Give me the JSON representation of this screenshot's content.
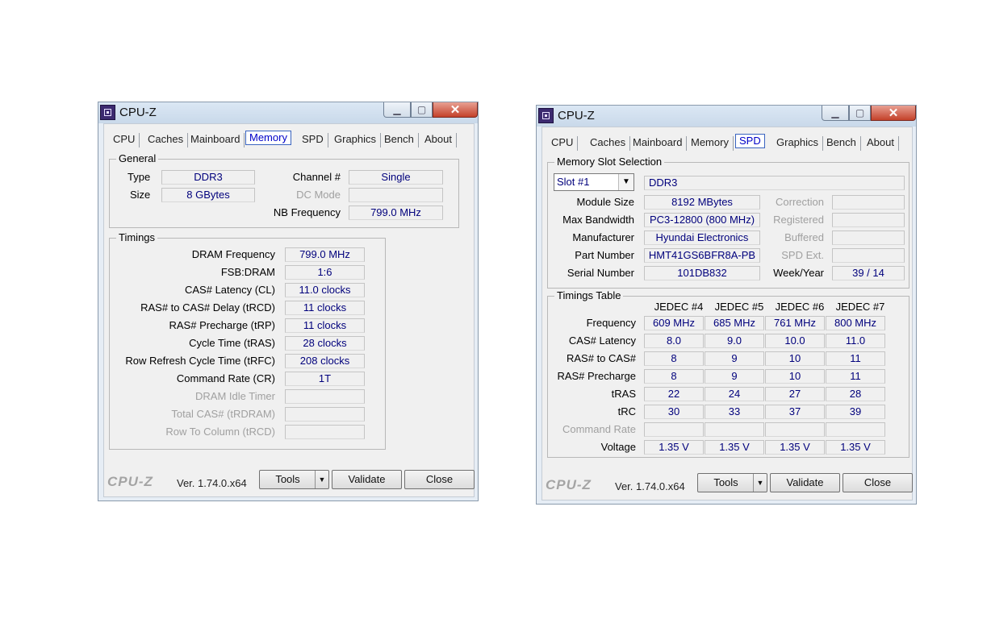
{
  "left_window": {
    "title": "CPU-Z",
    "tabs": [
      "CPU",
      "Caches",
      "Mainboard",
      "Memory",
      "SPD",
      "Graphics",
      "Bench",
      "About"
    ],
    "active_tab": "Memory",
    "general": {
      "label": "General",
      "type_label": "Type",
      "type_value": "DDR3",
      "size_label": "Size",
      "size_value": "8 GBytes",
      "channel_label": "Channel #",
      "channel_value": "Single",
      "dcmode_label": "DC Mode",
      "dcmode_value": "",
      "nbfreq_label": "NB Frequency",
      "nbfreq_value": "799.0 MHz"
    },
    "timings": {
      "label": "Timings",
      "rows": [
        {
          "label": "DRAM Frequency",
          "value": "799.0 MHz"
        },
        {
          "label": "FSB:DRAM",
          "value": "1:6"
        },
        {
          "label": "CAS# Latency (CL)",
          "value": "11.0 clocks"
        },
        {
          "label": "RAS# to CAS# Delay (tRCD)",
          "value": "11 clocks"
        },
        {
          "label": "RAS# Precharge (tRP)",
          "value": "11 clocks"
        },
        {
          "label": "Cycle Time (tRAS)",
          "value": "28 clocks"
        },
        {
          "label": "Row Refresh Cycle Time (tRFC)",
          "value": "208 clocks"
        },
        {
          "label": "Command Rate (CR)",
          "value": "1T"
        },
        {
          "label": "DRAM Idle Timer",
          "value": ""
        },
        {
          "label": "Total CAS# (tRDRAM)",
          "value": ""
        },
        {
          "label": "Row To Column (tRCD)",
          "value": ""
        }
      ]
    },
    "footer": {
      "logo": "CPU-Z",
      "version": "Ver. 1.74.0.x64",
      "tools": "Tools",
      "validate": "Validate",
      "close": "Close"
    }
  },
  "right_window": {
    "title": "CPU-Z",
    "tabs": [
      "CPU",
      "Caches",
      "Mainboard",
      "Memory",
      "SPD",
      "Graphics",
      "Bench",
      "About"
    ],
    "active_tab": "SPD",
    "slot_group": {
      "label": "Memory Slot Selection",
      "slot_select": "Slot #1",
      "slot_type": "DDR3",
      "module_size_label": "Module Size",
      "module_size": "8192 MBytes",
      "max_bw_label": "Max Bandwidth",
      "max_bw": "PC3-12800 (800 MHz)",
      "manufacturer_label": "Manufacturer",
      "manufacturer": "Hyundai Electronics",
      "part_label": "Part Number",
      "part": "HMT41GS6BFR8A-PB",
      "serial_label": "Serial Number",
      "serial": "101DB832",
      "correction_label": "Correction",
      "correction": "",
      "registered_label": "Registered",
      "registered": "",
      "buffered_label": "Buffered",
      "buffered": "",
      "spdext_label": "SPD Ext.",
      "spdext": "",
      "weekyear_label": "Week/Year",
      "weekyear": "39 / 14"
    },
    "timings_table": {
      "label": "Timings Table",
      "columns": [
        "JEDEC #4",
        "JEDEC #5",
        "JEDEC #6",
        "JEDEC #7"
      ],
      "rows": [
        {
          "label": "Frequency",
          "values": [
            "609 MHz",
            "685 MHz",
            "761 MHz",
            "800 MHz"
          ]
        },
        {
          "label": "CAS# Latency",
          "values": [
            "8.0",
            "9.0",
            "10.0",
            "11.0"
          ]
        },
        {
          "label": "RAS# to CAS#",
          "values": [
            "8",
            "9",
            "10",
            "11"
          ]
        },
        {
          "label": "RAS# Precharge",
          "values": [
            "8",
            "9",
            "10",
            "11"
          ]
        },
        {
          "label": "tRAS",
          "values": [
            "22",
            "24",
            "27",
            "28"
          ]
        },
        {
          "label": "tRC",
          "values": [
            "30",
            "33",
            "37",
            "39"
          ]
        },
        {
          "label": "Command Rate",
          "values": [
            "",
            "",
            "",
            ""
          ]
        },
        {
          "label": "Voltage",
          "values": [
            "1.35 V",
            "1.35 V",
            "1.35 V",
            "1.35 V"
          ]
        }
      ]
    },
    "footer": {
      "logo": "CPU-Z",
      "version": "Ver. 1.74.0.x64",
      "tools": "Tools",
      "validate": "Validate",
      "close": "Close"
    }
  }
}
